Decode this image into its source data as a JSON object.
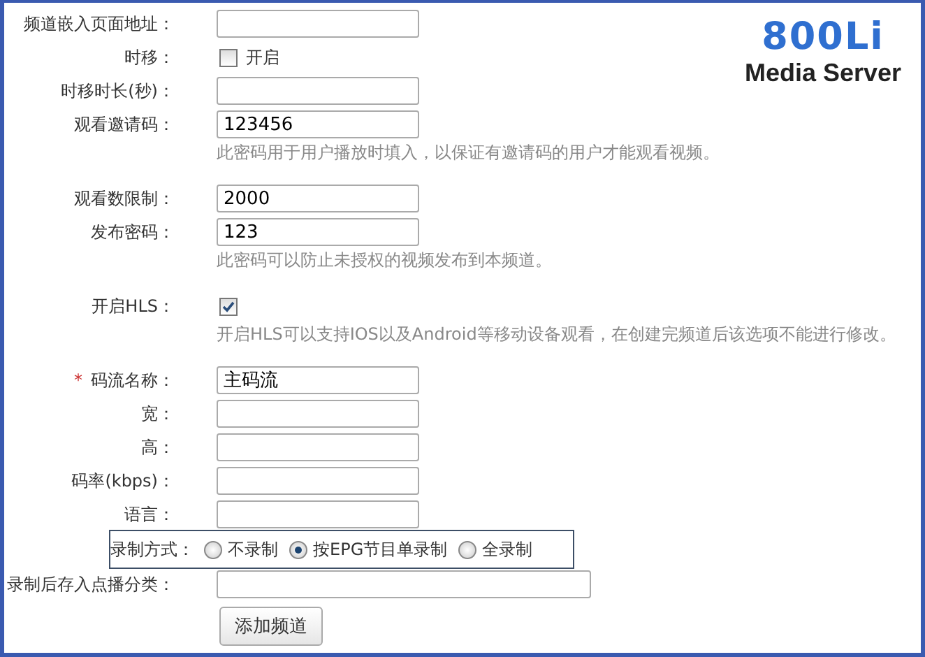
{
  "logo": {
    "mark": "800Li",
    "subtitle": "Media Server"
  },
  "fields": [
    {
      "kind": "text",
      "label": "频道嵌入页面地址："
    },
    {
      "kind": "checkbox",
      "label": "时移：",
      "option": "开启",
      "checked": false
    },
    {
      "kind": "text",
      "label": "时移时长(秒)："
    },
    {
      "kind": "text",
      "label": "观看邀请码：",
      "value": "123456",
      "hint": "此密码用于用户播放时填入，以保证有邀请码的用户才能观看视频。"
    },
    {
      "kind": "text",
      "label": "观看数限制：",
      "value": "2000"
    },
    {
      "kind": "text",
      "label": "发布密码：",
      "value": "123",
      "hint": "此密码可以防止未授权的视频发布到本频道。"
    },
    {
      "kind": "checkbox",
      "label": "开启HLS：",
      "checked": true,
      "hint": "开启HLS可以支持IOS以及Android等移动设备观看，在创建完频道后该选项不能进行修改。"
    },
    {
      "kind": "text",
      "label": "码流名称：",
      "marker": "*",
      "value": "主码流"
    },
    {
      "kind": "text",
      "label": "宽："
    },
    {
      "kind": "text",
      "label": "高："
    },
    {
      "kind": "text",
      "label": "码率(kbps)："
    },
    {
      "kind": "text",
      "label": "语言："
    },
    {
      "kind": "radio",
      "label": "录制方式：",
      "options": [
        {
          "label": "不录制",
          "selected": false
        },
        {
          "label": "按EPG节目单录制",
          "selected": true
        },
        {
          "label": "全录制",
          "selected": false
        }
      ]
    },
    {
      "kind": "wide",
      "label": "录制后存入点播分类："
    }
  ],
  "submit": "添加频道"
}
